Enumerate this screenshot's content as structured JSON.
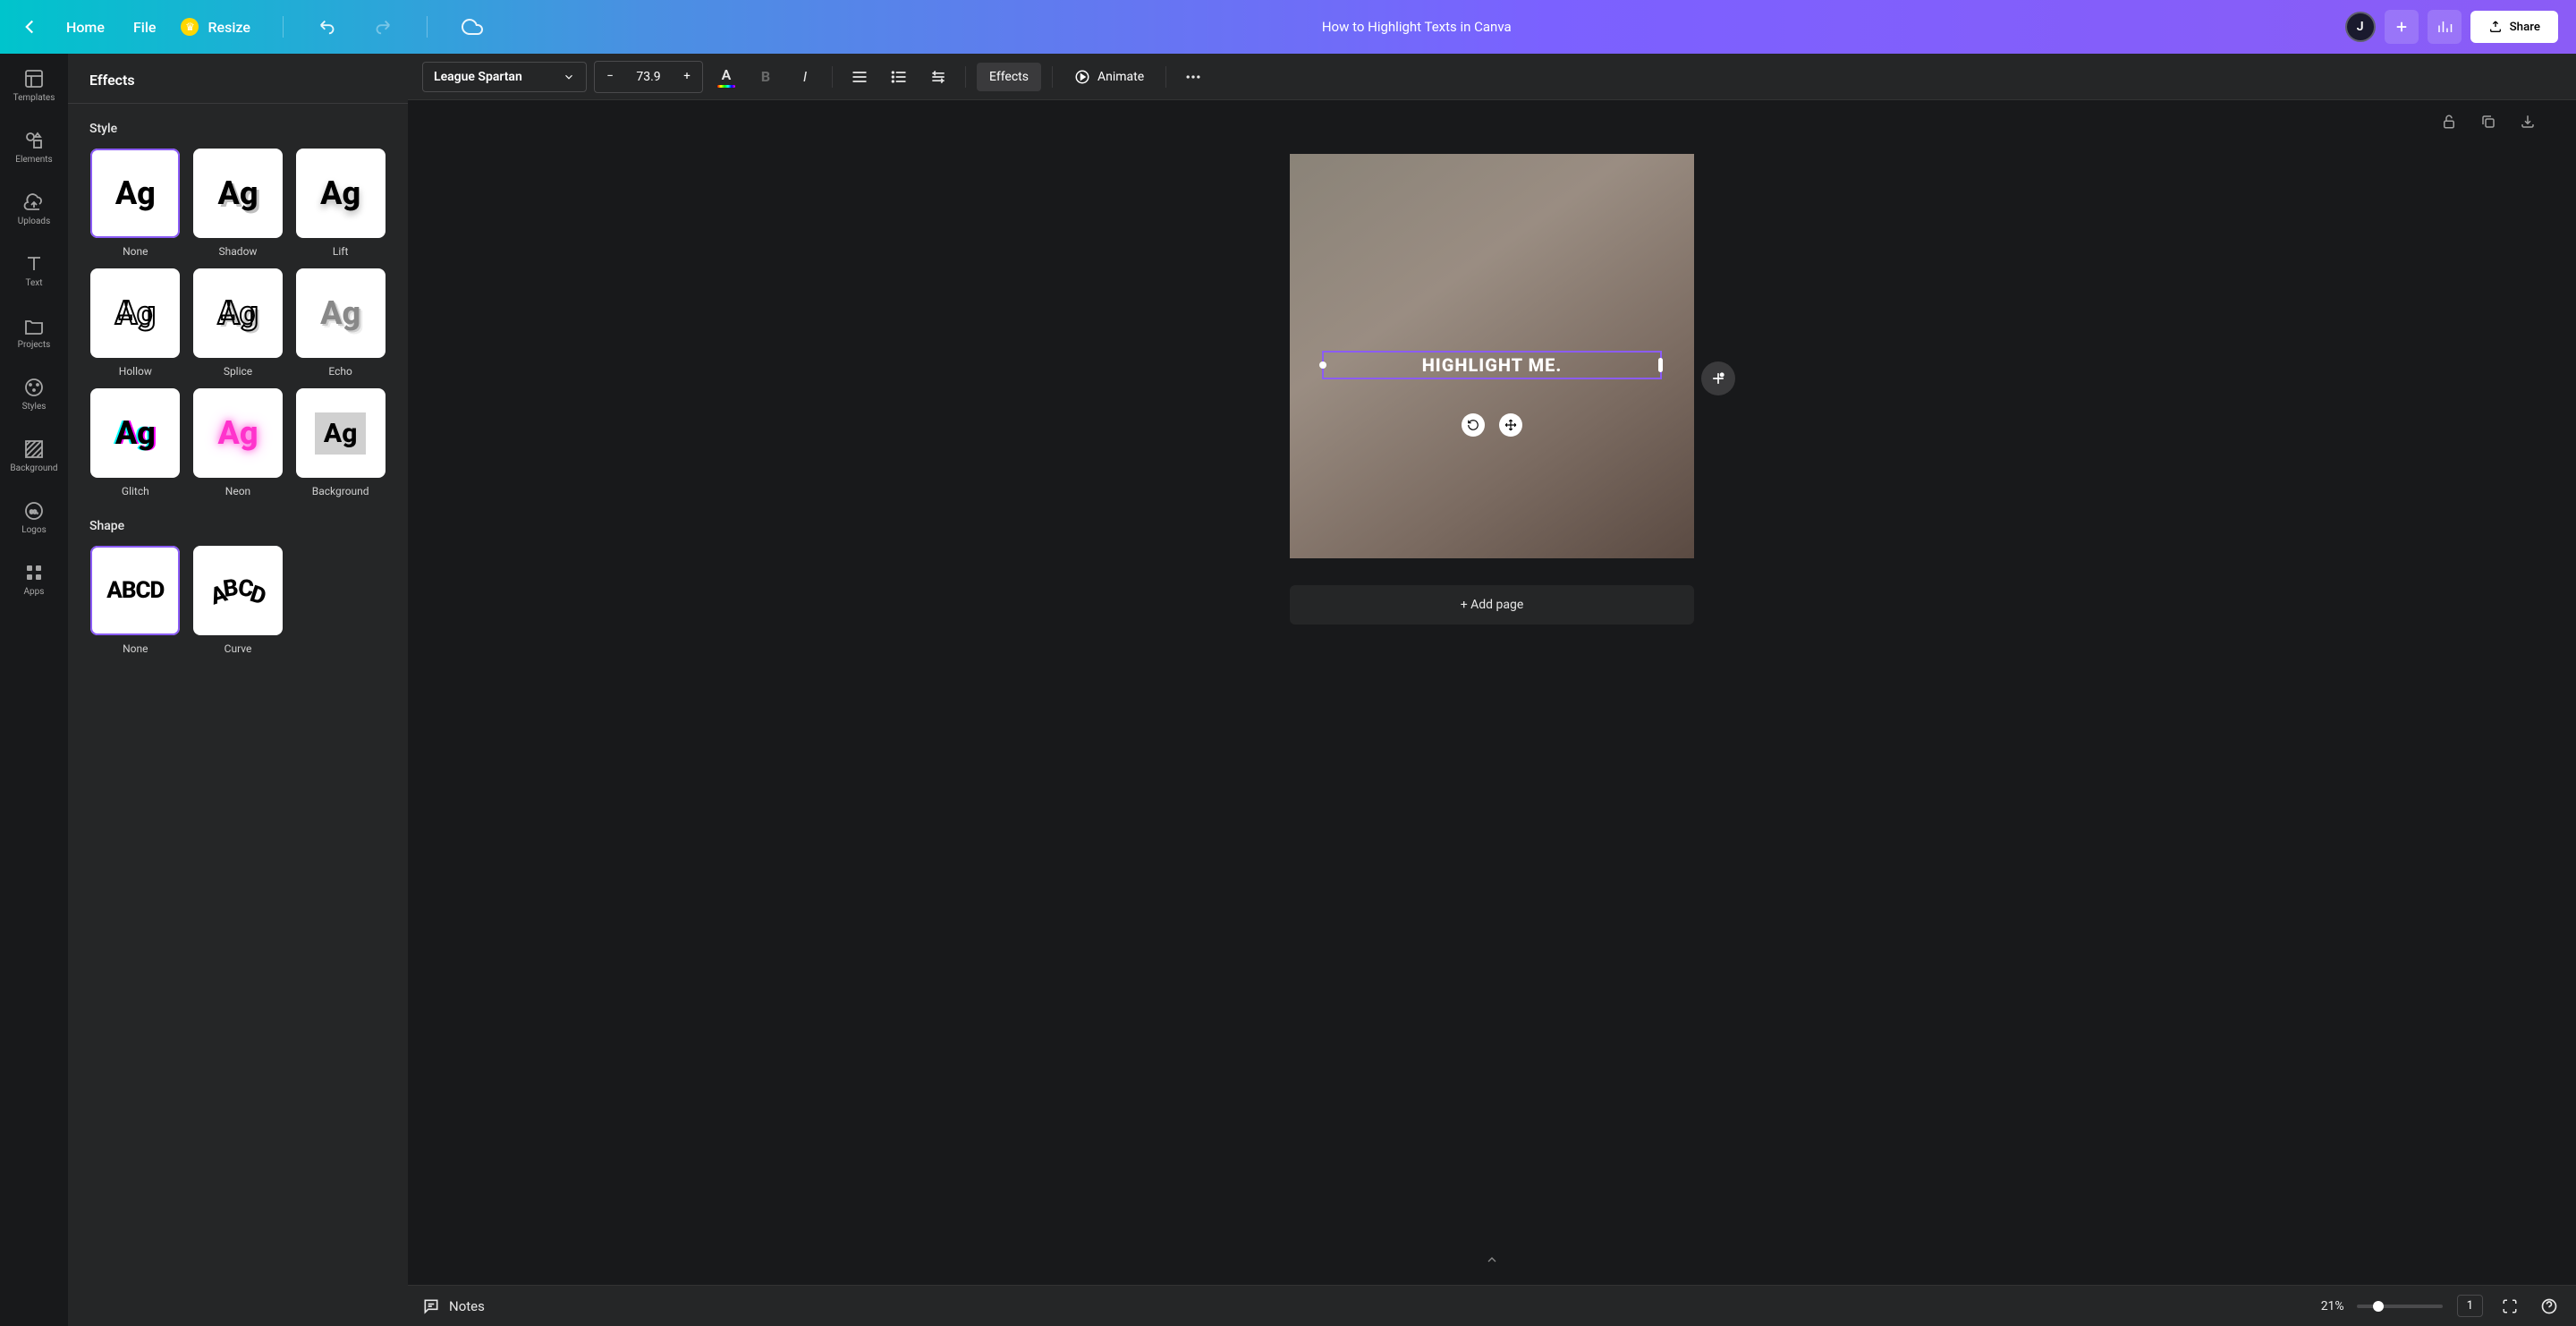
{
  "top": {
    "home": "Home",
    "file": "File",
    "resize": "Resize",
    "title": "How to Highlight Texts in Canva",
    "avatar_initial": "J",
    "share": "Share"
  },
  "rail": {
    "templates": "Templates",
    "elements": "Elements",
    "uploads": "Uploads",
    "text": "Text",
    "projects": "Projects",
    "styles": "Styles",
    "background": "Background",
    "logos": "Logos",
    "apps": "Apps"
  },
  "panel": {
    "title": "Effects",
    "style_heading": "Style",
    "shape_heading": "Shape",
    "styles": [
      {
        "label": "None",
        "sample": "Ag",
        "selected": true
      },
      {
        "label": "Shadow",
        "sample": "Ag"
      },
      {
        "label": "Lift",
        "sample": "Ag"
      },
      {
        "label": "Hollow",
        "sample": "Ag"
      },
      {
        "label": "Splice",
        "sample": "Ag"
      },
      {
        "label": "Echo",
        "sample": "Ag"
      },
      {
        "label": "Glitch",
        "sample": "Ag"
      },
      {
        "label": "Neon",
        "sample": "Ag"
      },
      {
        "label": "Background",
        "sample": "Ag"
      }
    ],
    "shapes": [
      {
        "label": "None",
        "sample": "ABCD",
        "selected": true
      },
      {
        "label": "Curve",
        "sample": "ABCD"
      }
    ]
  },
  "toolbar": {
    "font": "League Spartan",
    "size": "73.9",
    "effects": "Effects",
    "animate": "Animate"
  },
  "canvas": {
    "text": "HIGHLIGHT ME.",
    "add_page": "+ Add page"
  },
  "bottom": {
    "notes": "Notes",
    "zoom": "21%",
    "page": "1"
  }
}
